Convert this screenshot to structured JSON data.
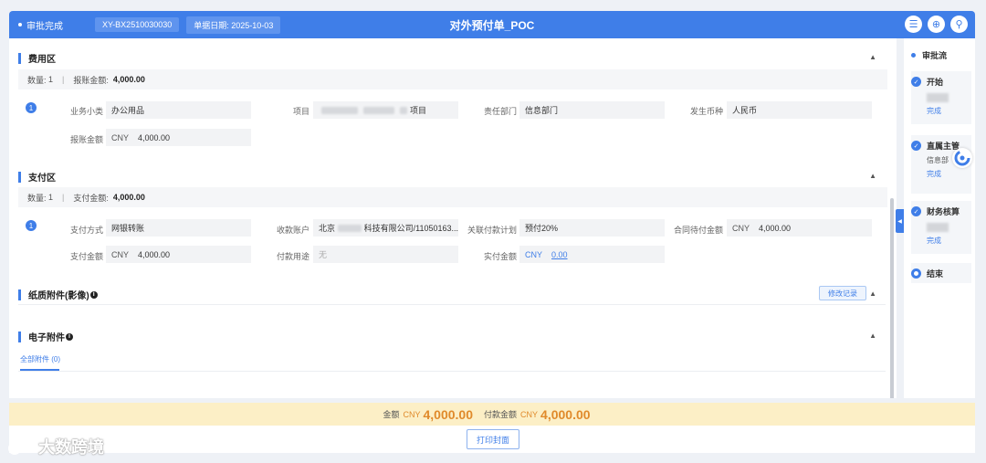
{
  "header": {
    "status": "审批完成",
    "doc_no": "XY-BX2510030030",
    "date_label": "单据日期:",
    "date_value": "2025-10-03",
    "title": "对外预付单_POC",
    "actions": [
      {
        "name": "list",
        "icon": "list-icon",
        "glyph": "☰"
      },
      {
        "name": "zoom",
        "icon": "zoom-icon",
        "glyph": "⊕"
      },
      {
        "name": "pin",
        "icon": "pin-icon",
        "glyph": "⚲"
      }
    ]
  },
  "expense": {
    "title": "费用区",
    "count_label": "数量:",
    "count": "1",
    "sum_label": "报账金额:",
    "sum": "4,000.00",
    "row_index": "1",
    "fields": {
      "category_label": "业务小类",
      "category": "办公用品",
      "project_label": "项目",
      "project_suffix": "项目",
      "dept_label": "责任部门",
      "dept": "信息部门",
      "currency_label": "发生币种",
      "currency": "人民币",
      "amount_label": "报账金额",
      "amount_cur": "CNY",
      "amount": "4,000.00"
    }
  },
  "payment": {
    "title": "支付区",
    "count_label": "数量:",
    "count": "1",
    "sum_label": "支付金额:",
    "sum": "4,000.00",
    "row_index": "1",
    "fields": {
      "method_label": "支付方式",
      "method": "网银转账",
      "account_label": "收款账户",
      "account_prefix": "北京",
      "account_suffix": "科技有限公司/11050163...",
      "plan_label": "关联付款计划",
      "plan": "预付20%",
      "contract_label": "合同待付金额",
      "contract_cur": "CNY",
      "contract_amt": "4,000.00",
      "pay_label": "支付金额",
      "pay_cur": "CNY",
      "pay_amt": "4,000.00",
      "usage_label": "付款用途",
      "usage": "无",
      "actual_label": "实付金额",
      "actual_cur": "CNY",
      "actual_amt": "0.00"
    }
  },
  "paper": {
    "title": "纸质附件(影像)",
    "edit_btn": "修改记录"
  },
  "electronic": {
    "title": "电子附件",
    "tab_all": "全部附件 (0)"
  },
  "flow": {
    "title": "审批流",
    "nodes": [
      {
        "name": "开始",
        "status": "完成"
      },
      {
        "name": "直属主管",
        "sub": "信息部",
        "status": "完成"
      },
      {
        "name": "财务核算",
        "status": "完成"
      },
      {
        "name": "结束"
      }
    ]
  },
  "totals": {
    "amount_label": "金额",
    "amount_cur": "CNY",
    "amount": "4,000.00",
    "pay_label": "付款金额",
    "pay_cur": "CNY",
    "pay": "4,000.00"
  },
  "footer": {
    "print_btn": "打印封面"
  },
  "watermark": {
    "brand": "大数跨境"
  },
  "colors": {
    "primary": "#3f7ee8",
    "amount": "#e08a2b",
    "total_bg": "#fcefc6"
  }
}
